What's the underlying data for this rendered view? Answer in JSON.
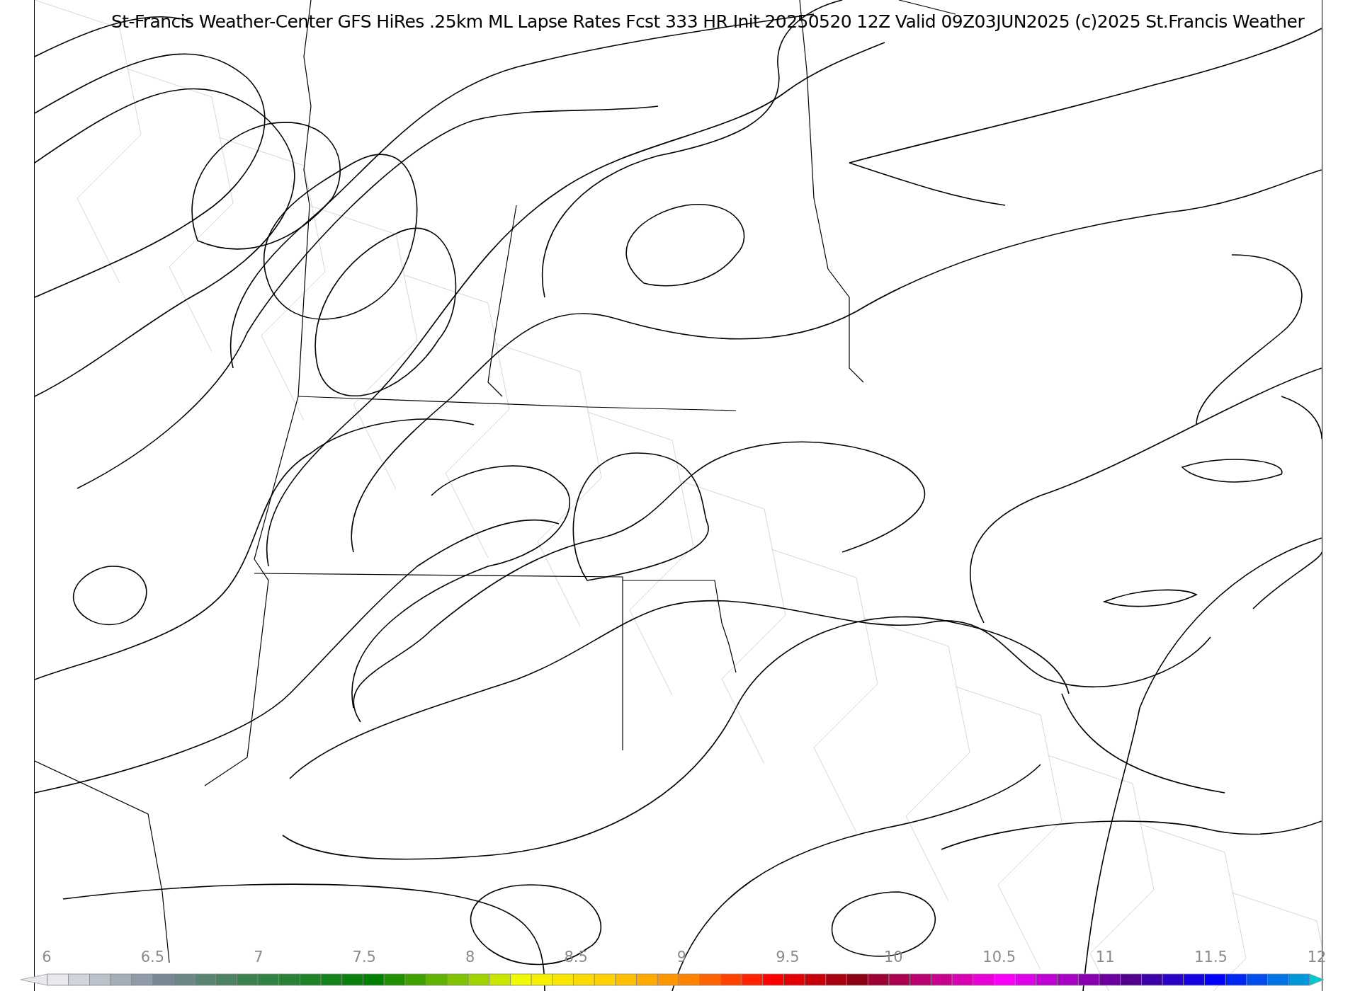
{
  "title": "St-Francis Weather-Center GFS HiRes .25km ML Lapse Rates  Fcst 333 HR Init 20250520 12Z  Valid 09Z03JUN2025    (c)2025 St.Francis Weather",
  "colorbar": {
    "ticks": [
      "6",
      "6.5",
      "7",
      "7.5",
      "8",
      "8.5",
      "9",
      "9.5",
      "10",
      "10.5",
      "11",
      "11.5",
      "12"
    ]
  }
}
